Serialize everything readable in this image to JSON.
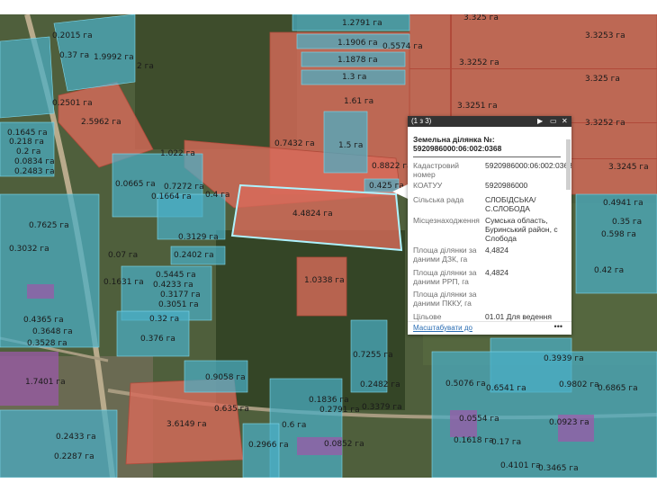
{
  "map": {
    "parcel_labels": [
      "1.2791 га",
      "3.325 га",
      "1.1906 га",
      "0.5574 га",
      "3.3253 га",
      "1.1878 га",
      "1.9992 га",
      "2 га",
      "3.3252 га",
      "0.37 га",
      "0.2015 га",
      "1.3 га",
      "3.325 га",
      "0.2501 га",
      "1.61 га",
      "3.3251 га",
      "2.5962 га",
      "0.1645 га",
      "0.218 га",
      "0.2 га",
      "0.0834 га",
      "0.2483 га",
      "0.7432 га",
      "1.5 га",
      "3.3252 га",
      "1.022 га",
      "0.8822 га",
      "0.0665 га",
      "0.7272 га",
      "0.1664 га",
      "0.4 га",
      "0.425 га",
      "3.3245 га",
      "0.4941 га",
      "4.4824 га",
      "0.35 га",
      "0.7625 га",
      "0.598 га",
      "0.3129 га",
      "0.3032 га",
      "0.07 га",
      "0.2402 га",
      "0.42 га",
      "0.5445 га",
      "0.1631 га",
      "0.4233 га",
      "0.3177 га",
      "1.0338 га",
      "0.3051 га",
      "0.4365 га",
      "0.3648 га",
      "0.3528 га",
      "0.32 га",
      "0.376 га",
      "0.7255 га",
      "0.3939 га",
      "1.7401 га",
      "0.9058 га",
      "0.2482 га",
      "0.5076 га",
      "0.6541 га",
      "0.9802 га",
      "0.6865 га",
      "0.1836 га",
      "0.2791 га",
      "0.3379 га",
      "0.635 га",
      "3.6149 га",
      "0.6 га",
      "0.0554 га",
      "0.0923 га",
      "0.2433 га",
      "0.2287 га",
      "0.2966 га",
      "0.0852 га",
      "0.1618 га",
      "0.17 га",
      "0.4101 га",
      "0.3465 га"
    ]
  },
  "popup": {
    "counter": "(1 з 3)",
    "play_icon": "play-icon",
    "maximize_icon": "maximize-icon",
    "close_icon": "close-icon",
    "title_line1": "Земельна ділянка №:",
    "title_line2": "5920986000:06:002:0368",
    "rows": [
      {
        "key": "Кадастровий номер",
        "value": "5920986000:06:002:0368"
      },
      {
        "key": "КОАТУУ",
        "value": "5920986000"
      },
      {
        "key": "Сільська рада",
        "value": "СЛОБІДСЬКА/ С.СЛОБОДА"
      },
      {
        "key": "Місцезнаходження",
        "value": "Сумська область, Буринський район, с Слобода"
      },
      {
        "key": "Площа ділянки за даними ДЗК, га",
        "value": "4,4824"
      },
      {
        "key": "Площа ділянки за даними РРП, га",
        "value": "4,4824"
      },
      {
        "key": "Площа ділянки за даними ПККУ, га",
        "value": ""
      },
      {
        "key": "Цільове",
        "value": "01.01 Для ведення"
      }
    ],
    "zoom_link": "Масштабувати до",
    "more": "•••"
  }
}
